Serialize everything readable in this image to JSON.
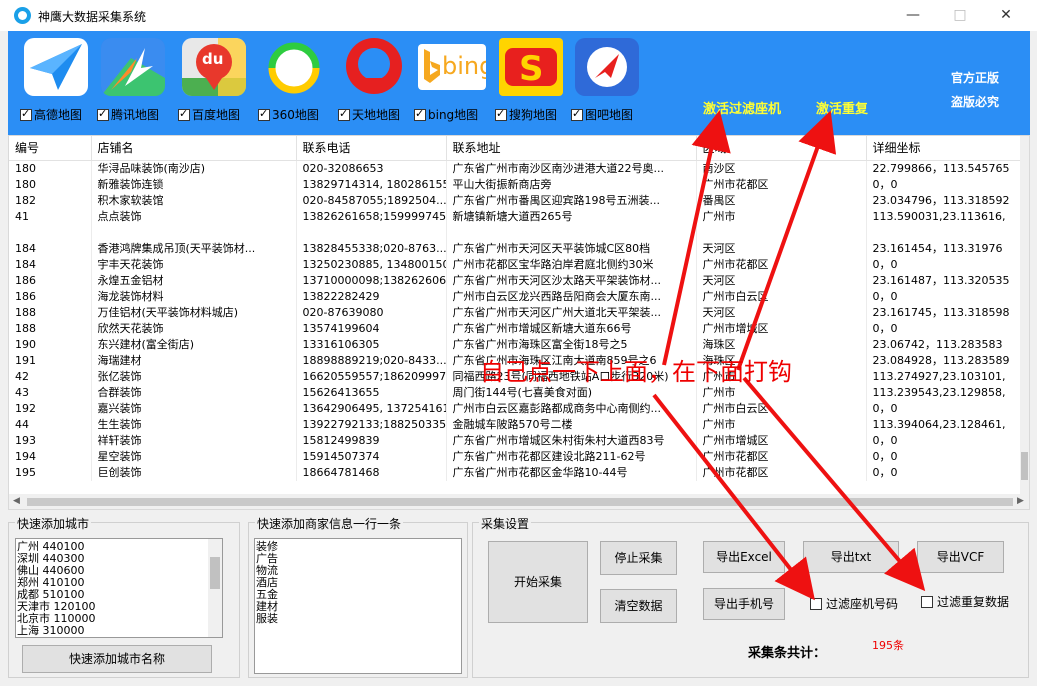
{
  "window": {
    "title": "神鹰大数据采集系统",
    "minimize": "—",
    "maximize": "□",
    "close": "✕"
  },
  "maps": [
    {
      "label": "高德地图",
      "checked": true,
      "icon": "amap-icon"
    },
    {
      "label": "腾讯地图",
      "checked": true,
      "icon": "tencent-map-icon"
    },
    {
      "label": "百度地图",
      "checked": true,
      "icon": "baidu-map-icon"
    },
    {
      "label": "360地图",
      "checked": true,
      "icon": "360-map-icon"
    },
    {
      "label": "天地地图",
      "checked": true,
      "icon": "tianditu-icon"
    },
    {
      "label": "bing地图",
      "checked": true,
      "icon": "bing-map-icon"
    },
    {
      "label": "搜狗地图",
      "checked": true,
      "icon": "sogou-map-icon"
    },
    {
      "label": "图吧地图",
      "checked": true,
      "icon": "mapbar-icon"
    }
  ],
  "banner": {
    "official": "官方正版",
    "piracy": "盗版必究",
    "activate_filter": "激活过滤座机",
    "activate_dup": "激活重复",
    "bing_text": "bing",
    "baidu_text": "du"
  },
  "table": {
    "columns": [
      "编号",
      "店铺名",
      "联系电话",
      "联系地址",
      "区域",
      "详细坐标"
    ],
    "rows": [
      [
        "180",
        "华浔品味装饰(南沙店)",
        "020-32086653",
        "广东省广州市南沙区南沙进港大道22号奥...",
        "南沙区",
        "22.799866，113.545765"
      ],
      [
        "180",
        "新雅装饰连锁",
        "13829714314, 18028615512",
        "平山大街振新商店旁",
        "广州市花都区",
        "0，0"
      ],
      [
        "182",
        "积木家软装馆",
        "020-84587055;1892504...",
        "广东省广州市番禺区迎宾路198号五洲装...",
        "番禺区",
        "23.034796，113.318592"
      ],
      [
        "41",
        "点点装饰",
        "13826261658;15999974529",
        "新塘镇新塘大道西265号",
        "广州市",
        "113.590031,23.113616,"
      ],
      [
        "",
        "",
        "",
        "",
        "",
        ""
      ],
      [
        "184",
        "香港鸿牌集成吊顶(天平装饰材...",
        "13828455338;020-8763...",
        "广东省广州市天河区天平装饰城C区80档",
        "天河区",
        "23.161454，113.31976"
      ],
      [
        "184",
        "宇丰天花装饰",
        "13250230885, 13480015001",
        "广州市花都区宝华路泊岸君庭北侧约30米",
        "广州市花都区",
        "0，0"
      ],
      [
        "186",
        "永煌五金铝材",
        "13710000098;13826260622",
        "广东省广州市天河区沙太路天平架装饰材...",
        "天河区",
        "23.161487，113.320535"
      ],
      [
        "186",
        "海龙装饰材料",
        "13822282429",
        "广州市白云区龙兴西路岳阳商会大厦东南...",
        "广州市白云区",
        "0，0"
      ],
      [
        "188",
        "万佳铝材(天平装饰材料城店)",
        "020-87639080",
        "广东省广州市天河区广州大道北天平架装...",
        "天河区",
        "23.161745，113.318598"
      ],
      [
        "188",
        "欣然天花装饰",
        "13574199604",
        "广东省广州市增城区新塘大道东66号",
        "广州市增城区",
        "0，0"
      ],
      [
        "190",
        "东兴建材(富全街店)",
        "13316106305",
        "广东省广州市海珠区富全街18号之5",
        "海珠区",
        "23.06742，113.283583"
      ],
      [
        "191",
        "海瑞建材",
        "18898889219;020-8433...",
        "广东省广州市海珠区江南大道南859号之6",
        "海珠区",
        "23.084928，113.283589"
      ],
      [
        "42",
        "张亿装饰",
        "16620559557;18620999703",
        "同福西路23号(同福西地铁站A口步行320米)",
        "广州市",
        "113.274927,23.103101,"
      ],
      [
        "43",
        "合群装饰",
        "15626413655",
        "周门街144号(七喜美食对面)",
        "广州市",
        "113.239543,23.129858,"
      ],
      [
        "192",
        "嘉兴装饰",
        "13642906495, 13725416175",
        "广州市白云区嘉彭路都成商务中心南侧约...",
        "广州市白云区",
        "0，0"
      ],
      [
        "44",
        "生生装饰",
        "13922792133;18825033556",
        "金融城车陂路570号二楼",
        "广州市",
        "113.394064,23.128461,"
      ],
      [
        "193",
        "祥轩装饰",
        "15812499839",
        "广东省广州市增城区朱村街朱村大道西83号",
        "广州市增城区",
        "0，0"
      ],
      [
        "194",
        "星空装饰",
        "15914507374",
        "广东省广州市花都区建设北路211-62号",
        "广州市花都区",
        "0，0"
      ],
      [
        "195",
        "巨创装饰",
        "18664781468",
        "广东省广州市花都区金华路10-44号",
        "广州市花都区",
        "0，0"
      ]
    ]
  },
  "city_panel": {
    "title": "快速添加城市",
    "cities": [
      "广州 440100",
      "深圳 440300",
      "佛山 440600",
      "郑州 410100",
      "成都 510100",
      "天津市 120100",
      "北京市 110000",
      "上海 310000"
    ],
    "button": "快速添加城市名称"
  },
  "merchant_panel": {
    "title": "快速添加商家信息一行一条",
    "items": [
      "装修",
      "广告",
      "物流",
      "酒店",
      "五金",
      "建材",
      "服装"
    ]
  },
  "collect_panel": {
    "title": "采集设置",
    "start": "开始采集",
    "stop": "停止采集",
    "clear": "清空数据",
    "export_excel": "导出Excel",
    "export_txt": "导出txt",
    "export_vcf": "导出VCF",
    "export_phone": "导出手机号",
    "filter_landline": "过滤座机号码",
    "filter_dup": "过滤重复数据",
    "count_label": "采集条共计：",
    "count_value": "195条"
  },
  "annotation": {
    "text": "自己点一下上面，在下面打钩",
    "arrow_color": "#ee1111"
  }
}
